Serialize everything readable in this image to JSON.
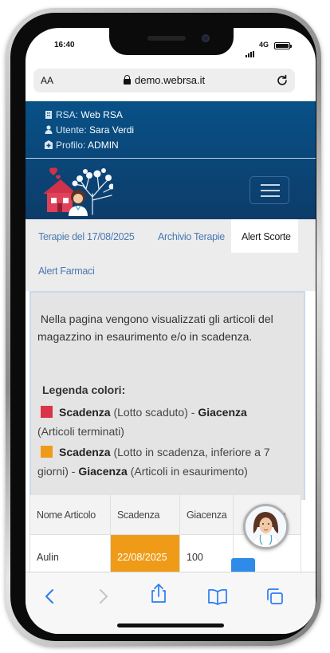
{
  "status_bar": {
    "time": "16:40",
    "network": "4G"
  },
  "browser": {
    "text_size_label": "AA",
    "url": "demo.webrsa.it"
  },
  "header": {
    "rsa_label": "RSA:",
    "rsa_value": "Web RSA",
    "user_label": "Utente:",
    "user_value": "Sara Verdi",
    "profile_label": "Profilo:",
    "profile_value": "ADMIN"
  },
  "tabs": [
    {
      "label": "Terapie del 17/08/2025",
      "active": false
    },
    {
      "label": "Archivio Terapie",
      "active": false
    },
    {
      "label": "Alert Scorte",
      "active": true
    },
    {
      "label": "Alert Farmaci",
      "active": false
    }
  ],
  "info": {
    "description": "Nella pagina vengono visualizzati gli articoli del magazzino in esaurimento e/o in scadenza.",
    "legend_title": "Legenda colori:",
    "legend": [
      {
        "color": "#d9344a",
        "strong1": "Scadenza",
        "text1": " (Lotto scaduto) - ",
        "strong2": "Giacenza",
        "text2": " (Articoli terminati)"
      },
      {
        "color": "#ef9b17",
        "strong1": "Scadenza",
        "text1": " (Lotto in scadenza, inferiore a 7 giorni) - ",
        "strong2": "Giacenza",
        "text2": " (Articoli in esaurimento)"
      }
    ]
  },
  "table": {
    "headers": [
      "Nome Articolo",
      "Scadenza",
      "Giacenza",
      "Ordinato"
    ],
    "rows": [
      {
        "name": "Aulin",
        "expiry": "22/08/2025",
        "stock": "100",
        "expiry_color": "#ef9b17"
      }
    ]
  },
  "colors": {
    "header_blue": "#085187",
    "tab_link": "#4a79b2",
    "order_button": "#2e8be8"
  }
}
